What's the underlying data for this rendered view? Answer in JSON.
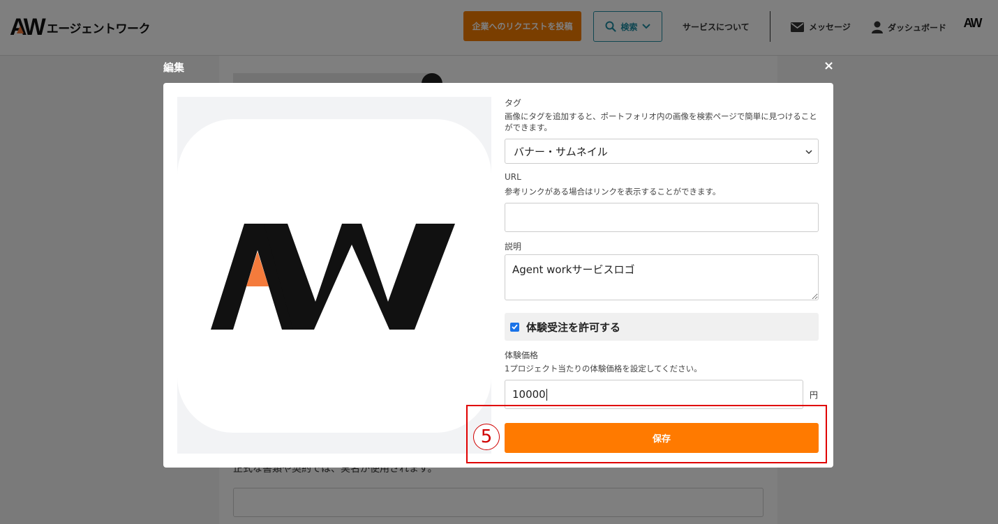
{
  "header": {
    "logo_mark": "AW",
    "logo_text": "エージェントワーク",
    "request_button": "企業へのリクエストを投稿",
    "search_button": "検索",
    "about_link": "サービスについて",
    "messages_link": "メッセージ",
    "dashboard_link": "ダッシュボード",
    "avatar_text": "AW"
  },
  "background": {
    "note_text": "正式な書類や契約では、実名が使用されます。"
  },
  "modal": {
    "title": "編集",
    "close": "×",
    "preview_logo": "AW",
    "tag_label": "タグ",
    "tag_help": "画像にタグを追加すると、ポートフォリオ内の画像を検索ページで簡単に見つけることができます。",
    "tag_value": "バナー・サムネイル",
    "url_label": "URL",
    "url_help": "参考リンクがある場合はリンクを表示することができます。",
    "url_value": "",
    "desc_label": "説明",
    "desc_value": "Agent workサービスロゴ",
    "trial_checkbox_label": "体験受注を許可する",
    "trial_checked": true,
    "price_label": "体験価格",
    "price_help": "1プロジェクト当たりの体験価格を設定してください。",
    "price_value": "10000",
    "price_unit": "円",
    "save_button": "保存"
  },
  "annotation": {
    "step_number": "5"
  },
  "colors": {
    "accent_orange": "#ff7a00",
    "search_teal": "#1f8da3",
    "logo_orange": "#f47b3c",
    "highlight_red": "#e00000"
  }
}
